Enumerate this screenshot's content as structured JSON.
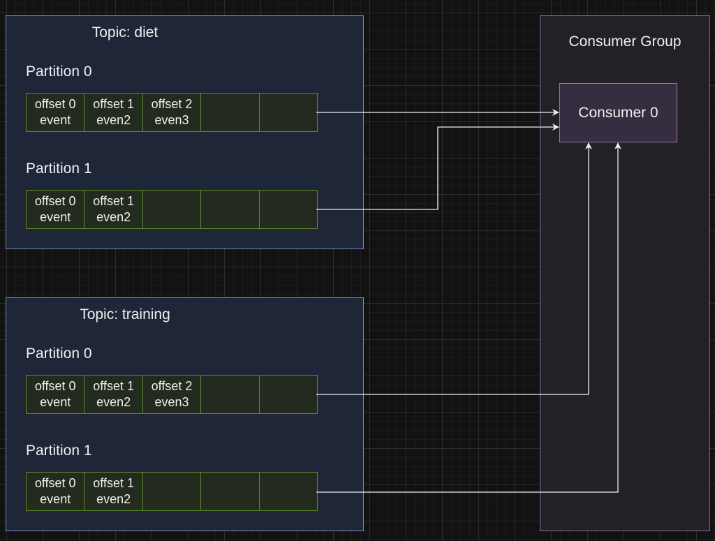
{
  "topics": [
    {
      "title": "Topic: diet",
      "partitions": [
        {
          "label": "Partition 0",
          "cells": [
            [
              "offset 0",
              "event"
            ],
            [
              "offset 1",
              "even2"
            ],
            [
              "offset 2",
              "even3"
            ],
            [
              "",
              ""
            ],
            [
              "",
              ""
            ]
          ]
        },
        {
          "label": "Partition 1",
          "cells": [
            [
              "offset 0",
              "event"
            ],
            [
              "offset 1",
              "even2"
            ],
            [
              "",
              ""
            ],
            [
              "",
              ""
            ],
            [
              "",
              ""
            ]
          ]
        }
      ]
    },
    {
      "title": "Topic: training",
      "partitions": [
        {
          "label": "Partition 0",
          "cells": [
            [
              "offset 0",
              "event"
            ],
            [
              "offset 1",
              "even2"
            ],
            [
              "offset 2",
              "even3"
            ],
            [
              "",
              ""
            ],
            [
              "",
              ""
            ]
          ]
        },
        {
          "label": "Partition 1",
          "cells": [
            [
              "offset 0",
              "event"
            ],
            [
              "offset 1",
              "even2"
            ],
            [
              "",
              ""
            ],
            [
              "",
              ""
            ],
            [
              "",
              ""
            ]
          ]
        }
      ]
    }
  ],
  "consumer_group": {
    "title": "Consumer Group",
    "consumers": [
      "Consumer 0"
    ]
  },
  "colors": {
    "topic_fill": "#1e2638",
    "topic_border": "#6c8ebf",
    "cell_fill": "#222b1e",
    "cell_border": "#5a8a2e",
    "group_fill": "#232127",
    "group_border": "#8a6a9a",
    "consumer_fill": "#362d41",
    "arrow": "#eeeeee"
  }
}
